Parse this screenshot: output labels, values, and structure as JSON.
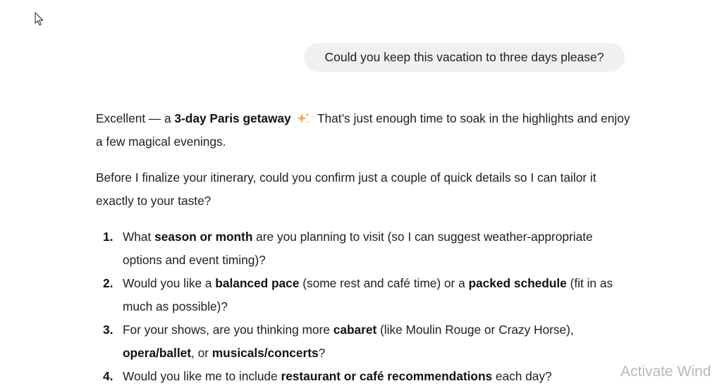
{
  "cursor_icon": "mouse-pointer-icon",
  "user_message": "Could you keep this vacation to three days please?",
  "response": {
    "p1": {
      "pre": "Excellent — a ",
      "bold": "3-day Paris getaway",
      "icon": "sparkle-icon",
      "post": " That’s just enough time to soak in the highlights and enjoy a few magical evenings."
    },
    "p2": "Before I finalize your itinerary, could you confirm just a couple of quick details so I can tailor it exactly to your taste?",
    "questions": [
      {
        "num": "1.",
        "t1": "What ",
        "b1": "season or month",
        "t2": " are you planning to visit (so I can suggest weather-appropriate options and event timing)?"
      },
      {
        "num": "2.",
        "t1": "Would you like a ",
        "b1": "balanced pace",
        "t2": " (some rest and café time) or a ",
        "b2": "packed schedule",
        "t3": " (fit in as much as possible)?"
      },
      {
        "num": "3.",
        "t1": "For your shows, are you thinking more ",
        "b1": "cabaret",
        "t2": " (like Moulin Rouge or Crazy Horse), ",
        "b2": "opera/ballet",
        "t3": ", or ",
        "b3": "musicals/concerts",
        "t4": "?"
      },
      {
        "num": "4.",
        "t1": "Would you like me to include ",
        "b1": "restaurant or café recommendations",
        "t2": " each day?"
      }
    ]
  },
  "watermark": "Activate Wind",
  "colors": {
    "bubble_bg": "#f0f0f0",
    "text": "#202020",
    "sparkle": "#f4a340",
    "watermark": "#b8b8b8"
  }
}
